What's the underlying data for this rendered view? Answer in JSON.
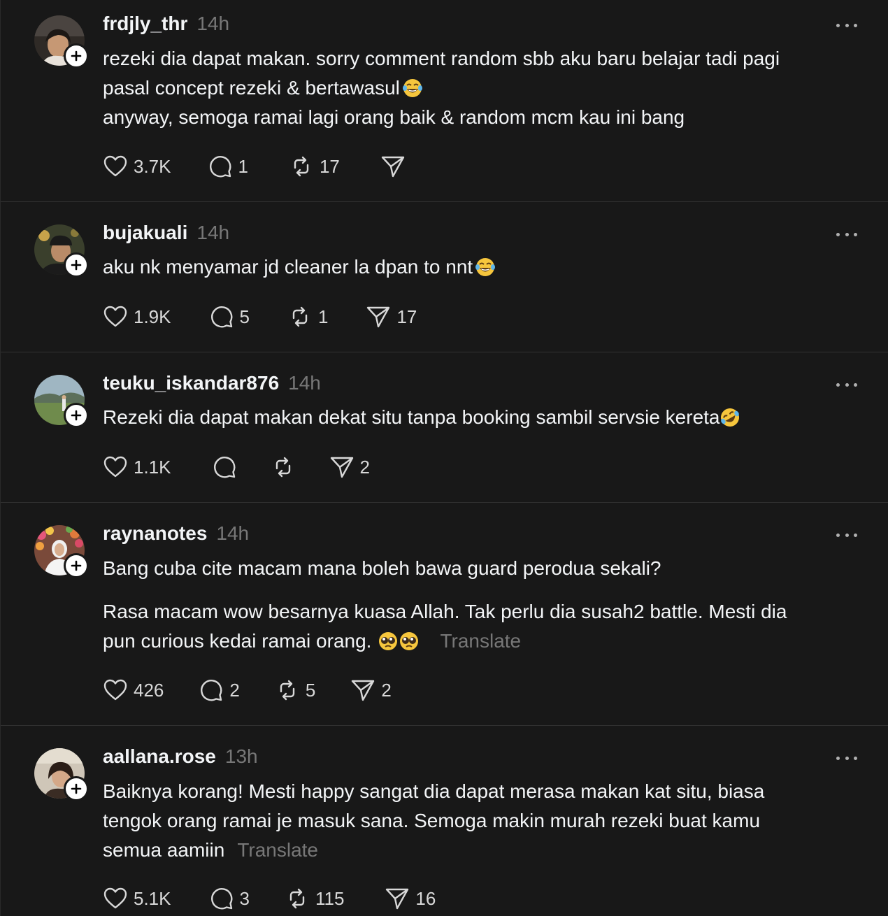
{
  "posts": [
    {
      "username": "frdjly_thr",
      "time": "14h",
      "lines": [
        [
          "rezeki dia dapat makan. sorry comment random sbb aku baru belajar tadi pagi"
        ],
        [
          "pasal concept rezeki & bertawasul"
        ],
        [
          "anyway, semoga ramai lagi orang baik & random mcm kau ini bang"
        ]
      ],
      "likes": "3.7K",
      "replies": "1",
      "reposts": "17",
      "shares": ""
    },
    {
      "username": "bujakuali",
      "time": "14h",
      "lines": [
        [
          "aku nk menyamar jd cleaner la dpan to nnt"
        ]
      ],
      "likes": "1.9K",
      "replies": "5",
      "reposts": "1",
      "shares": "17"
    },
    {
      "username": "teuku_iskandar876",
      "time": "14h",
      "lines": [
        [
          "Rezeki dia dapat makan dekat situ tanpa booking sambil servsie kereta"
        ]
      ],
      "likes": "1.1K",
      "replies": "",
      "reposts": "",
      "shares": "2"
    },
    {
      "username": "raynanotes",
      "time": "14h",
      "lines": [
        [
          "Bang cuba cite macam mana boleh bawa guard perodua sekali?"
        ],
        [
          "Rasa macam wow besarnya kuasa Allah. Tak perlu dia susah2 battle. Mesti dia"
        ],
        [
          "pun curious kedai ramai orang."
        ]
      ],
      "translate": "Translate",
      "likes": "426",
      "replies": "2",
      "reposts": "5",
      "shares": "2"
    },
    {
      "username": "aallana.rose",
      "time": "13h",
      "lines": [
        [
          "Baiknya korang! Mesti happy sangat dia dapat merasa makan kat situ, biasa"
        ],
        [
          "tengok orang ramai je masuk sana. Semoga makin murah rezeki buat kamu"
        ],
        [
          "semua aamiin"
        ]
      ],
      "translate": "Translate",
      "likes": "5.1K",
      "replies": "3",
      "reposts": "115",
      "shares": "16"
    }
  ],
  "icons": {
    "like": "heart-icon",
    "reply": "speech-bubble-icon",
    "repost": "repost-arrows-icon",
    "share": "paper-plane-icon",
    "more": "more-horizontal-icon",
    "follow": "plus-icon",
    "emoji_joy": "face-with-tears-of-joy-emoji",
    "emoji_rofl": "rolling-on-the-floor-laughing-emoji",
    "emoji_pleading": "pleading-face-emoji"
  },
  "colors": {
    "background": "#181818",
    "text": "#f3f5f7",
    "muted": "#777777",
    "divider": "#323232"
  }
}
